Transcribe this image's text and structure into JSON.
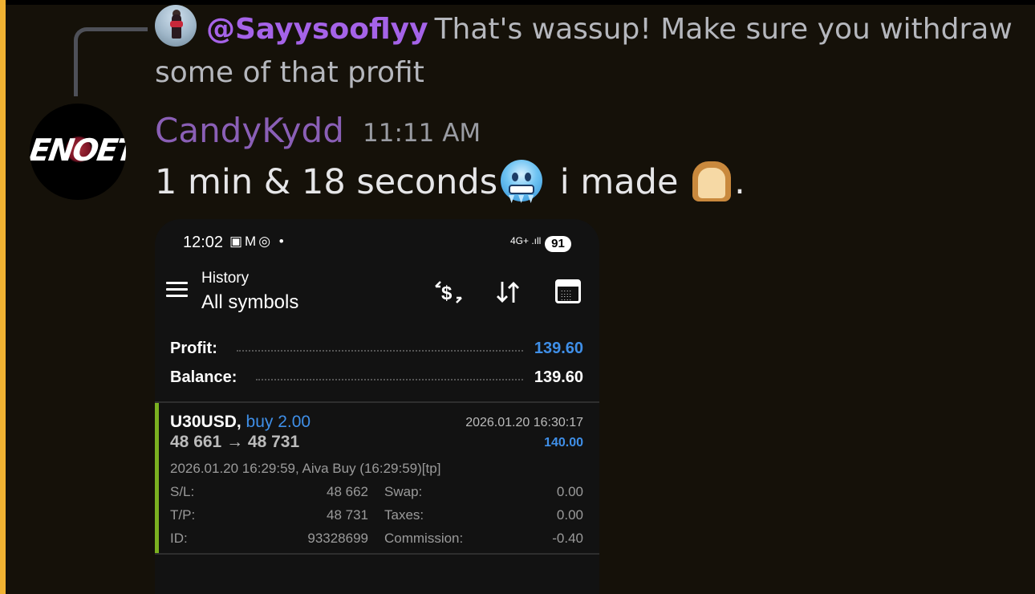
{
  "reply": {
    "mention": "@Sayysooflyy",
    "text": "That's wassup! Make sure you withdraw some of that profit"
  },
  "message": {
    "username": "CandyKydd",
    "timestamp": "11:11 AM",
    "avatar_text": "ENOETI",
    "text_part1": "1 min & 18 seconds",
    "emoji1": "cold-face-emoji",
    "text_part2": " i made ",
    "emoji2": "bread-emoji",
    "text_part3": "."
  },
  "phone": {
    "status": {
      "time": "12:02",
      "icons": "▣M◎ •",
      "network": "4G+ .ıll",
      "battery": "91"
    },
    "header": {
      "subtitle": "History",
      "title": "All symbols"
    },
    "summary": {
      "profit_label": "Profit:",
      "profit_value": "139.60",
      "balance_label": "Balance:",
      "balance_value": "139.60"
    },
    "trade": {
      "symbol": "U30USD,",
      "side": "buy 2.00",
      "prices": "48 661 → 48 731",
      "close_time": "2026.01.20 16:30:17",
      "profit": "140.00",
      "comment": "2026.01.20 16:29:59, Aiva Buy (16:29:59)[tp]",
      "sl_label": "S/L:",
      "sl_value": "48 662",
      "tp_label": "T/P:",
      "tp_value": "48 731",
      "id_label": "ID:",
      "id_value": "93328699",
      "swap_label": "Swap:",
      "swap_value": "0.00",
      "taxes_label": "Taxes:",
      "taxes_value": "0.00",
      "commission_label": "Commission:",
      "commission_value": "-0.40"
    }
  },
  "colors": {
    "accent_bar": "#f0b232",
    "mention": "#a563e8",
    "username": "#8a5fb6",
    "profit_blue": "#3f8fe8",
    "trade_bar": "#7ab020"
  }
}
